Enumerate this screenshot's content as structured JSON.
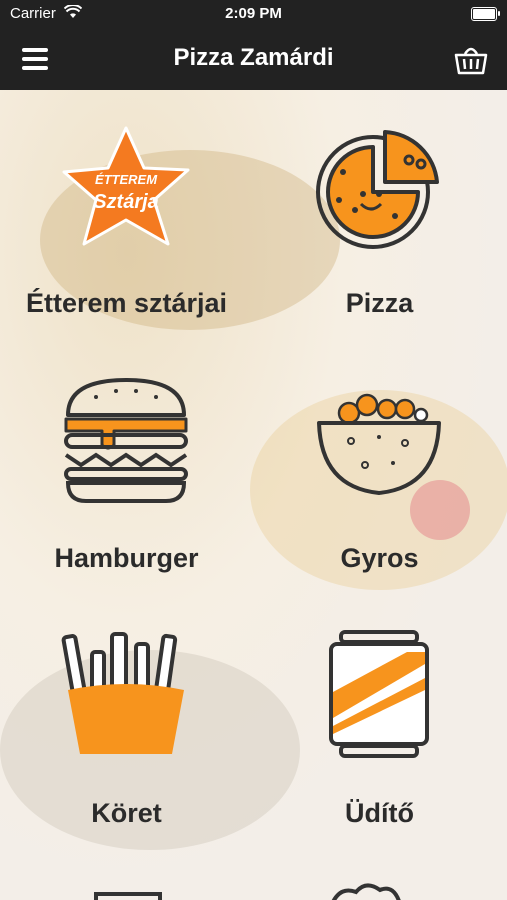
{
  "status_bar": {
    "carrier": "Carrier",
    "time": "2:09 PM"
  },
  "nav": {
    "title": "Pizza Zamárdi",
    "menu_icon": "hamburger-menu-icon",
    "cart_icon": "basket-icon"
  },
  "star_badge": {
    "line1": "ÉTTEREM",
    "line2": "Sztárja"
  },
  "categories": [
    {
      "label": "Étterem sztárjai",
      "icon": "star-badge-icon"
    },
    {
      "label": "Pizza",
      "icon": "pizza-icon"
    },
    {
      "label": "Hamburger",
      "icon": "hamburger-icon"
    },
    {
      "label": "Gyros",
      "icon": "gyros-bowl-icon"
    },
    {
      "label": "Köret",
      "icon": "fries-icon"
    },
    {
      "label": "Üdítő",
      "icon": "soda-can-icon"
    }
  ],
  "colors": {
    "bar": "#222222",
    "accent": "#F7941D",
    "outline": "#333333"
  }
}
